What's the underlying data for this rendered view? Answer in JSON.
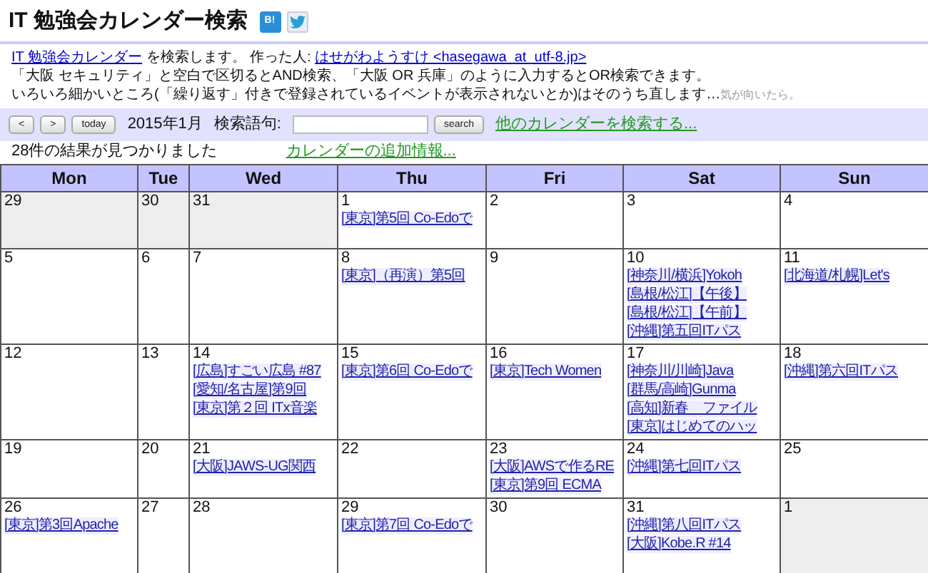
{
  "title": "IT 勉強会カレンダー検索",
  "share_buttons": [
    {
      "kind": "bookmark",
      "label": "B!"
    },
    {
      "kind": "bird"
    }
  ],
  "intro": {
    "calendar_link": "IT 勉強会カレンダー",
    "text": " を検索します。 作った人: ",
    "author_link": "はせがわようすけ <hasegawa  at  utf-8.jp>"
  },
  "help_text": "「大阪 セキュリティ」と空白で区切るとAND検索、「大阪 OR 兵庫」のように入力するとOR検索できます。",
  "todo_text": "いろいろ細かいところ(「繰り返す」付きで登録されているイベントが表示されないとか)はそのうち直します…",
  "todo_note": "気が向いたら。",
  "toolbar": {
    "prev": "<",
    "next": ">",
    "today": "today",
    "month": "2015年1月",
    "search_label": "検索語句:",
    "search_button": "search",
    "other_link": "他のカレンダーを検索する..."
  },
  "result_count": "28件の結果が見つかりました",
  "info_link": "カレンダーの追加情報...",
  "weekdays": [
    "Mon",
    "Tue",
    "Wed",
    "Thu",
    "Fri",
    "Sat",
    "Sun"
  ],
  "weeks": [
    [
      {
        "date": "29",
        "other_month": true
      },
      {
        "date": "30",
        "other_month": true
      },
      {
        "date": "31",
        "other_month": true
      },
      {
        "date": "1",
        "other_month": false,
        "events": [
          "[東京]第5回 Co-Edoで"
        ]
      },
      {
        "date": "2",
        "other_month": false
      },
      {
        "date": "3",
        "other_month": false
      },
      {
        "date": "4",
        "other_month": false
      }
    ],
    [
      {
        "date": "5",
        "other_month": false
      },
      {
        "date": "6",
        "other_month": false
      },
      {
        "date": "7",
        "other_month": false
      },
      {
        "date": "8",
        "other_month": false,
        "events": [
          "[東京]（再演）第5回"
        ]
      },
      {
        "date": "9",
        "other_month": false
      },
      {
        "date": "10",
        "other_month": false,
        "events": [
          "[神奈川/横浜]Yokoh",
          "[島根/松江]【午後】",
          "[島根/松江]【午前】",
          "[沖縄]第五回ITパス"
        ]
      },
      {
        "date": "11",
        "other_month": false,
        "events": [
          "[北海道/札幌]Let's"
        ]
      }
    ],
    [
      {
        "date": "12",
        "other_month": false
      },
      {
        "date": "13",
        "other_month": false
      },
      {
        "date": "14",
        "other_month": false,
        "events": [
          "[広島]すごい広島 #87",
          "[愛知/名古屋]第9回",
          "[東京]第２回 ITx音楽"
        ]
      },
      {
        "date": "15",
        "other_month": false,
        "events": [
          "[東京]第6回 Co-Edoで"
        ]
      },
      {
        "date": "16",
        "other_month": false,
        "events": [
          "[東京]Tech Women"
        ]
      },
      {
        "date": "17",
        "other_month": false,
        "events": [
          "[神奈川/川崎]Java",
          "[群馬/高崎]Gunma",
          "[高知]新春　ファイル",
          "[東京]はじめてのハッ"
        ]
      },
      {
        "date": "18",
        "other_month": false,
        "events": [
          "[沖縄]第六回ITパス"
        ]
      }
    ],
    [
      {
        "date": "19",
        "other_month": false
      },
      {
        "date": "20",
        "other_month": false
      },
      {
        "date": "21",
        "other_month": false,
        "events": [
          "[大阪]JAWS-UG関西"
        ]
      },
      {
        "date": "22",
        "other_month": false
      },
      {
        "date": "23",
        "other_month": false,
        "events": [
          "[大阪]AWSで作るRE",
          "[東京]第9回 ECMA"
        ]
      },
      {
        "date": "24",
        "other_month": false,
        "events": [
          "[沖縄]第七回ITパス"
        ]
      },
      {
        "date": "25",
        "other_month": false
      }
    ],
    [
      {
        "date": "26",
        "other_month": false,
        "events": [
          "[東京]第3回Apache"
        ]
      },
      {
        "date": "27",
        "other_month": false
      },
      {
        "date": "28",
        "other_month": false
      },
      {
        "date": "29",
        "other_month": false,
        "events": [
          "[東京]第7回 Co-Edoで"
        ]
      },
      {
        "date": "30",
        "other_month": false
      },
      {
        "date": "31",
        "other_month": false,
        "events": [
          "[沖縄]第八回ITパス",
          "[大阪]Kobe.R #14"
        ]
      },
      {
        "date": "1",
        "other_month": true
      }
    ]
  ]
}
